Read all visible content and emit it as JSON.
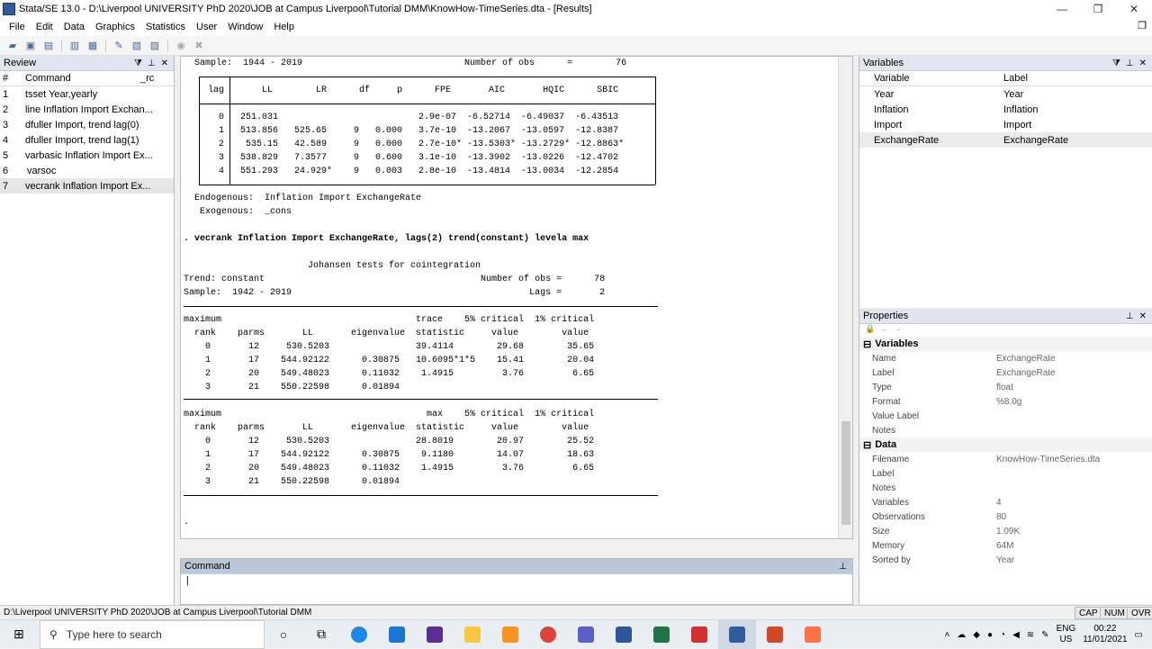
{
  "window": {
    "title": "Stata/SE 13.0 - D:\\Liverpool UNIVERSITY PhD 2020\\JOB at Campus Liverpool\\Tutorial DMM\\KnowHow-TimeSeries.dta - [Results]",
    "minimize": "—",
    "maximize": "❐",
    "close": "✕"
  },
  "menu": [
    "File",
    "Edit",
    "Data",
    "Graphics",
    "Statistics",
    "User",
    "Window",
    "Help"
  ],
  "review": {
    "title": "Review",
    "col_num": "#",
    "col_command": "Command",
    "col_rc": "_rc",
    "items": [
      {
        "n": "1",
        "cmd": "tsset Year,yearly"
      },
      {
        "n": "2",
        "cmd": "line Inflation Import Exchan..."
      },
      {
        "n": "3",
        "cmd": "dfuller Import, trend lag(0)"
      },
      {
        "n": "4",
        "cmd": "dfuller Import, trend lag(1)"
      },
      {
        "n": "5",
        "cmd": "varbasic Inflation Import Ex..."
      },
      {
        "n": "6",
        "cmd": "varsoc"
      },
      {
        "n": "7",
        "cmd": "vecrank Inflation Import Ex..."
      }
    ]
  },
  "results": {
    "top_text": "  Sample:  1944 - 2019                              Number of obs      =        76",
    "lag_table": "  lag       LL        LR      df     p      FPE       AIC       HQIC      SBIC\n\n    0   251.031                          2.9e-07  -6.52714  -6.49037  -6.43513\n    1   513.856   525.65     9   0.000   3.7e-10  -13.2067  -13.0597  -12.8387\n    2    535.15   42.589     9   0.000   2.7e-10* -13.5303* -13.2729* -12.8863*\n    3   538.829   7.3577     9   0.600   3.1e-10  -13.3902  -13.0226  -12.4702\n    4   551.293   24.929*    9   0.003   2.8e-10  -13.4814  -13.0034  -12.2854",
    "endo_text": "  Endogenous:  Inflation Import ExchangeRate\n   Exogenous:  _cons",
    "command_line": ". vecrank Inflation Import ExchangeRate, lags(2) trend(constant) levela max",
    "johansen_header": "                       Johansen tests for cointegration\nTrend: constant                                        Number of obs =      78\nSample:  1942 - 2019                                            Lags =       2",
    "trace_table": "maximum                                    trace    5% critical  1% critical\n  rank    parms       LL       eigenvalue  statistic     value        value\n    0       12     530.5203                39.4114        29.68        35.65\n    1       17    544.92122      0.30875   10.6095*1*5    15.41        20.04\n    2       20    549.48023      0.11032    1.4915         3.76         6.65\n    3       21    550.22598      0.01894",
    "max_table": "maximum                                      max    5% critical  1% critical\n  rank    parms       LL       eigenvalue  statistic     value        value\n    0       12     530.5203                28.8019        20.97        25.52\n    1       17    544.92122      0.30875    9.1180        14.07        18.63\n    2       20    549.48023      0.11032    1.4915         3.76         6.65\n    3       21    550.22598      0.01894",
    "prompt": "."
  },
  "command_pane": {
    "title": "Command"
  },
  "variables": {
    "title": "Variables",
    "col_variable": "Variable",
    "col_label": "Label",
    "rows": [
      {
        "name": "Year",
        "label": "Year"
      },
      {
        "name": "Inflation",
        "label": "Inflation"
      },
      {
        "name": "Import",
        "label": "Import"
      },
      {
        "name": "ExchangeRate",
        "label": "ExchangeRate"
      }
    ]
  },
  "properties": {
    "title": "Properties",
    "sec_variables": "Variables",
    "var_props": [
      {
        "k": "Name",
        "v": "ExchangeRate"
      },
      {
        "k": "Label",
        "v": "ExchangeRate"
      },
      {
        "k": "Type",
        "v": "float"
      },
      {
        "k": "Format",
        "v": "%8.0g"
      },
      {
        "k": "Value Label",
        "v": ""
      },
      {
        "k": "Notes",
        "v": ""
      }
    ],
    "sec_data": "Data",
    "data_props": [
      {
        "k": "Filename",
        "v": "KnowHow-TimeSeries.dta"
      },
      {
        "k": "Label",
        "v": ""
      },
      {
        "k": "Notes",
        "v": ""
      },
      {
        "k": "Variables",
        "v": "4"
      },
      {
        "k": "Observations",
        "v": "80"
      },
      {
        "k": "Size",
        "v": "1.09K"
      },
      {
        "k": "Memory",
        "v": "64M"
      },
      {
        "k": "Sorted by",
        "v": "Year"
      }
    ]
  },
  "statusbar": {
    "path": "D:\\Liverpool UNIVERSITY PhD 2020\\JOB at Campus Liverpool\\Tutorial DMM",
    "cap": "CAP",
    "num": "NUM",
    "ovr": "OVR"
  },
  "taskbar": {
    "search_placeholder": "Type here to search",
    "lang": "ENG",
    "region": "US",
    "time": "00:22",
    "date": "11/01/2021"
  }
}
